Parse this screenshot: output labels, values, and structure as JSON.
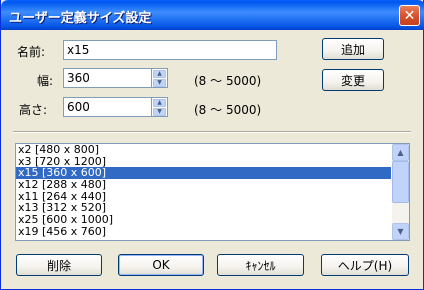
{
  "window": {
    "title": "ユーザー定義サイズ設定",
    "close_label": "✕"
  },
  "form": {
    "name_label": "名前:",
    "name_value": "x15",
    "width_label": "幅:",
    "width_value": "360",
    "width_range": "(8 ～ 5000)",
    "height_label": "高さ:",
    "height_value": "600",
    "height_range": "(8 ～ 5000)"
  },
  "side_buttons": {
    "add_label": "追加",
    "change_label": "変更"
  },
  "list": {
    "items": [
      "x2 [480 x 800]",
      "x3 [720 x 1200]",
      "x15 [360 x 600]",
      "x12 [288 x 480]",
      "x11 [264 x 440]",
      "x13 [312 x 520]",
      "x25 [600 x 1000]",
      "x19 [456 x 760]"
    ],
    "selected_index": 2,
    "scroll_up": "▲",
    "scroll_down": "▼"
  },
  "bottom_buttons": {
    "delete_label": "削除",
    "ok_label": "OK",
    "cancel_label": "ｷｬﾝｾﾙ",
    "help_label": "ヘルプ(H)"
  }
}
